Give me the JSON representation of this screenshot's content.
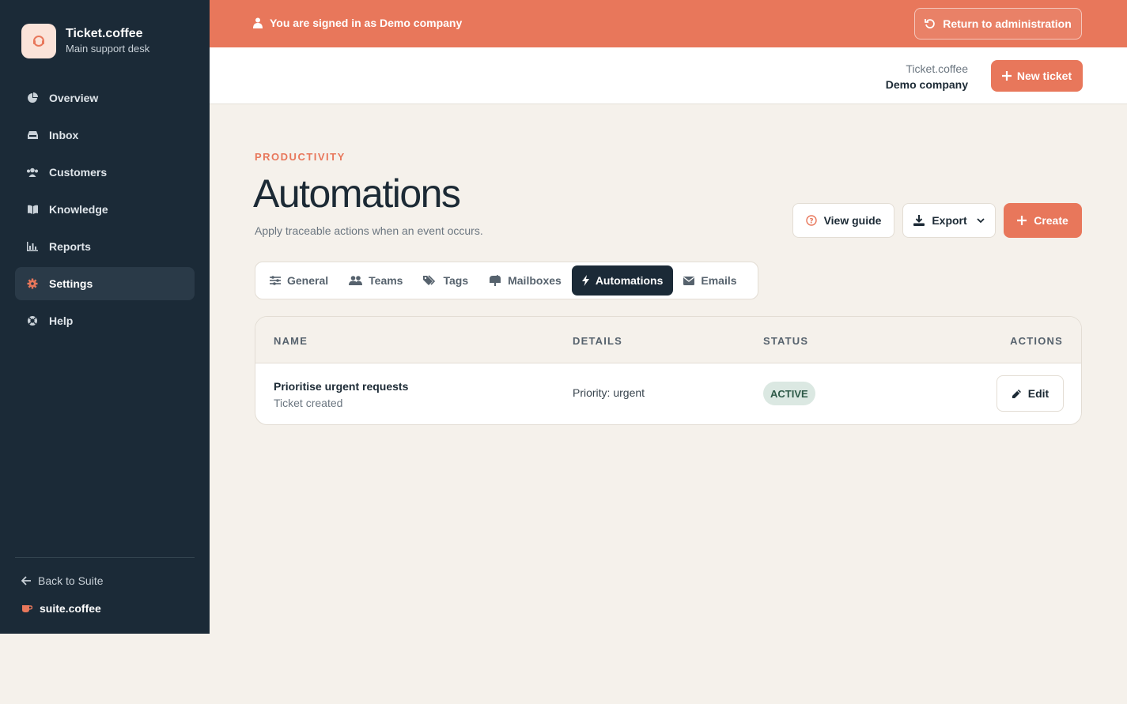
{
  "sidebar": {
    "brand_title": "Ticket.coffee",
    "brand_subtitle": "Main support desk",
    "items": [
      {
        "label": "Overview",
        "icon": "pie-chart-icon"
      },
      {
        "label": "Inbox",
        "icon": "inbox-icon"
      },
      {
        "label": "Customers",
        "icon": "users-icon"
      },
      {
        "label": "Knowledge",
        "icon": "book-icon"
      },
      {
        "label": "Reports",
        "icon": "bar-chart-icon"
      },
      {
        "label": "Settings",
        "icon": "gear-icon",
        "active": true
      },
      {
        "label": "Help",
        "icon": "lifebuoy-icon"
      }
    ],
    "back_label": "Back to Suite",
    "suite_label": "suite.coffee"
  },
  "banner": {
    "text": "You are signed in as Demo company",
    "return_label": "Return to administration"
  },
  "topbar": {
    "app_name": "Ticket.coffee",
    "company": "Demo company",
    "new_ticket_label": "New ticket"
  },
  "page": {
    "eyebrow": "PRODUCTIVITY",
    "title": "Automations",
    "subtitle": "Apply traceable actions when an event occurs.",
    "view_guide_label": "View guide",
    "export_label": "Export",
    "create_label": "Create"
  },
  "tabs": [
    {
      "label": "General",
      "icon": "sliders-icon"
    },
    {
      "label": "Teams",
      "icon": "users-icon"
    },
    {
      "label": "Tags",
      "icon": "tags-icon"
    },
    {
      "label": "Mailboxes",
      "icon": "mailbox-icon"
    },
    {
      "label": "Automations",
      "icon": "bolt-icon",
      "active": true
    },
    {
      "label": "Emails",
      "icon": "envelope-icon"
    }
  ],
  "table": {
    "columns": [
      "NAME",
      "DETAILS",
      "STATUS",
      "ACTIONS"
    ],
    "rows": [
      {
        "name": "Prioritise urgent requests",
        "trigger": "Ticket created",
        "details": "Priority: urgent",
        "status": "ACTIVE",
        "action_label": "Edit"
      }
    ]
  },
  "colors": {
    "accent": "#e8775b",
    "sidebar_bg": "#1b2a37",
    "page_bg": "#f5f1eb",
    "status_active_bg": "#dbe8e2"
  }
}
